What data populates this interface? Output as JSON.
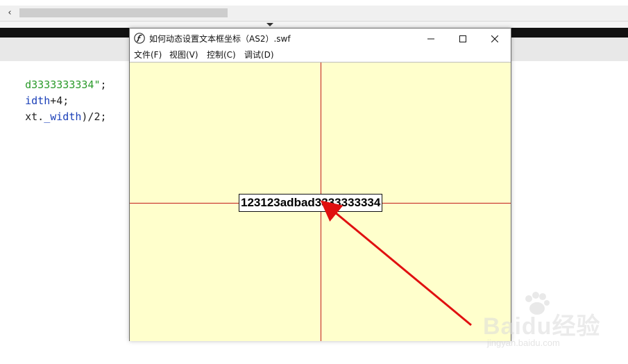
{
  "editor": {
    "scroll_left_glyph": "‹",
    "code_lines": [
      {
        "text": "d3333333334\";",
        "color": "green"
      },
      {
        "text": "idth+4;",
        "color": "blue"
      },
      {
        "text": "xt._width)/2;",
        "color": "mixed"
      }
    ],
    "line3_parts": [
      "xt.",
      "_width",
      ")/2;"
    ],
    "line2_parts": [
      "idth",
      "+4;"
    ],
    "line1_parts": [
      "d3333333334\"",
      ";"
    ]
  },
  "player": {
    "title": "如何动态设置文本框坐标（AS2）.swf",
    "menu": [
      "文件(F)",
      "视图(V)",
      "控制(C)",
      "调试(D)"
    ],
    "textfield_value": "123123adbad3333333334",
    "stage_color": "#ffffcc",
    "line_color": "#c21a1a",
    "arrow_color": "#e01010"
  },
  "watermark": {
    "logo": "Baidu经验",
    "sub": "jingyan.baidu.com"
  }
}
